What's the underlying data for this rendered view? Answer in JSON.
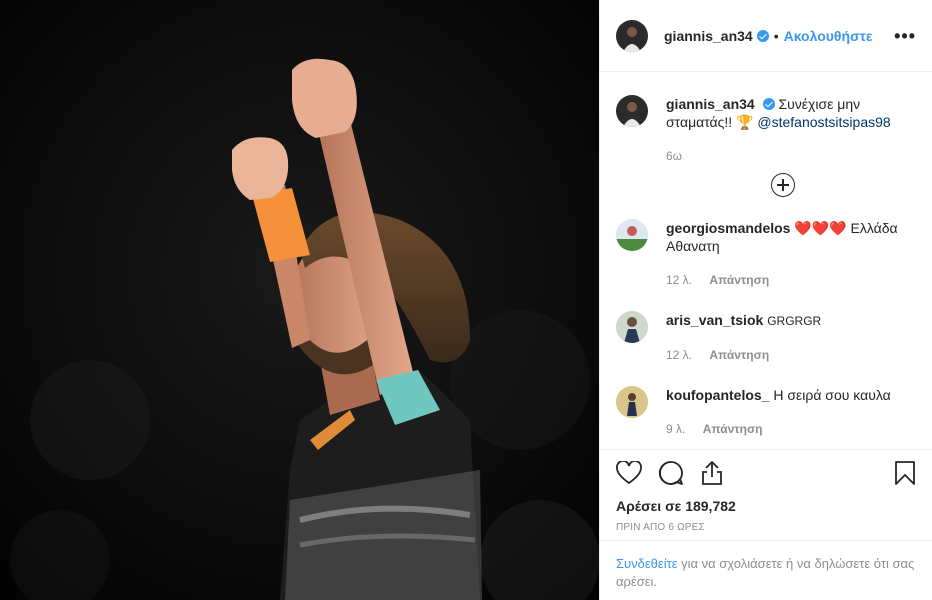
{
  "post": {
    "author": "giannis_an34",
    "follow_label": "Ακολουθήστε",
    "separator": "•",
    "more_label": "•••"
  },
  "caption": {
    "user": "giannis_an34",
    "text": "Συνέχισε μην σταματάς!! 🏆",
    "mention": "@stefanostsitsipas98",
    "time": "6ω"
  },
  "comments": [
    {
      "user": "georgiosmandelos",
      "text_hearts": "❤️❤️❤️",
      "text": "Ελλάδα Αθανατη",
      "ago": "12 λ.",
      "reply": "Απάντηση"
    },
    {
      "user": "aris_van_tsiok",
      "text": "GRGRGR",
      "ago": "12 λ.",
      "reply": "Απάντηση"
    },
    {
      "user": "koufopantelos_",
      "text": "Η σειρά σου καυλα",
      "ago": "9 λ.",
      "reply": "Απάντηση"
    }
  ],
  "actions": {
    "likes": "Αρέσει σε 189,782",
    "posted": "ΠΡΙΝ ΑΠΟ 6 ΩΡΕΣ"
  },
  "login": {
    "link": "Συνδεθείτε",
    "text": " για να σχολιάσετε ή να δηλώσετε ότι σας αρέσει."
  },
  "icons": {
    "like": "heart-icon",
    "comment": "comment-icon",
    "share": "share-icon",
    "save": "bookmark-icon",
    "add": "plus-circle-icon",
    "verified": "verified-badge-icon"
  },
  "colors": {
    "accent": "#3897f0",
    "muted": "#8e8e8e",
    "text": "#262626",
    "wristband": "#f5913a"
  }
}
